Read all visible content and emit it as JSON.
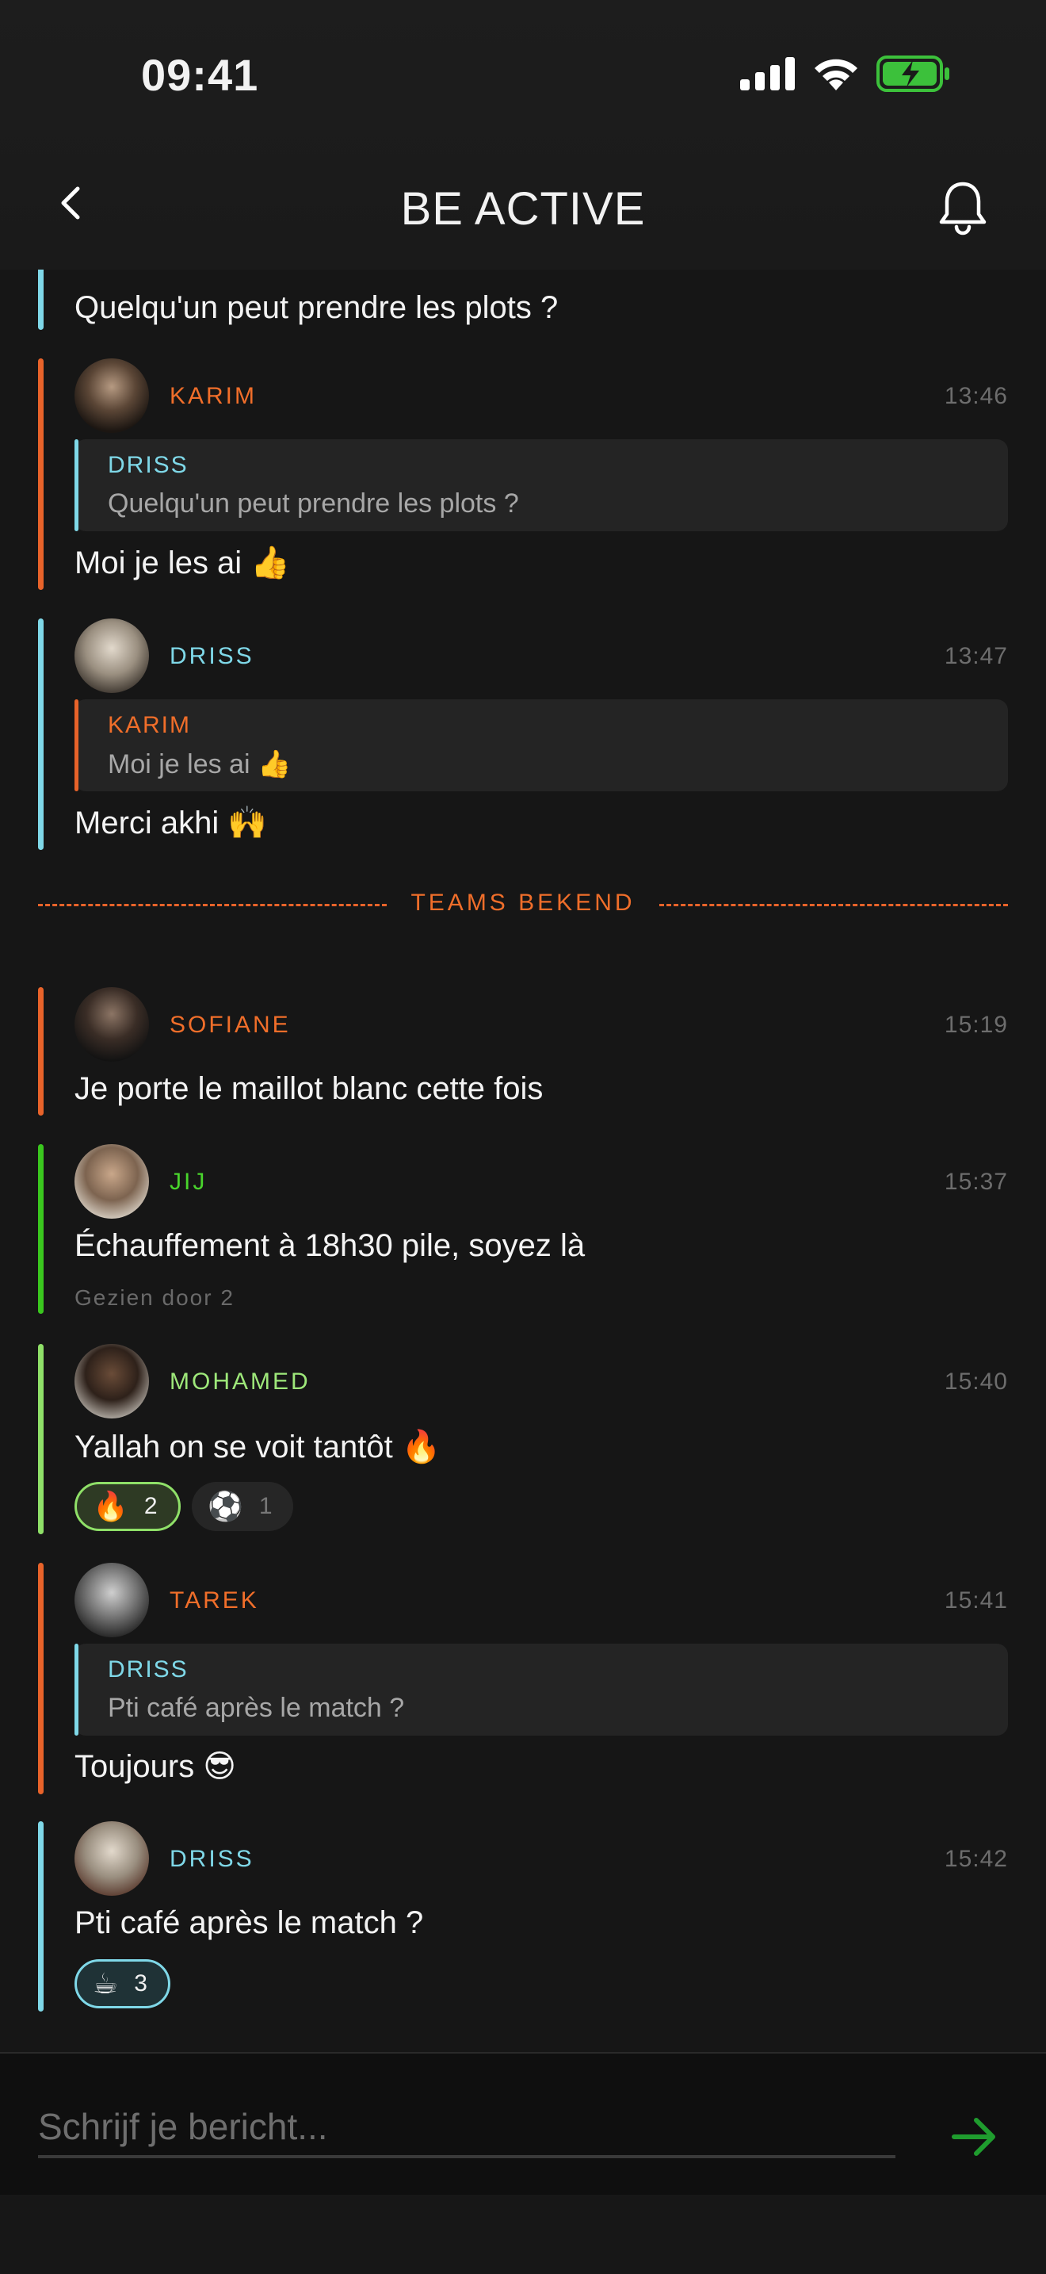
{
  "status_bar": {
    "time": "09:41"
  },
  "header": {
    "title": "BE ACTIVE"
  },
  "messages": [
    {
      "text": "Quelqu'un peut prendre les plots ?"
    },
    {
      "name": "KARIM",
      "time": "13:46",
      "quote_name": "DRISS",
      "quote_text": "Quelqu'un peut prendre les plots ?",
      "text": "Moi je les ai 👍"
    },
    {
      "name": "DRISS",
      "time": "13:47",
      "quote_name": "KARIM",
      "quote_text": "Moi je les ai 👍",
      "text": "Merci akhi 🙌"
    },
    {
      "name": "SOFIANE",
      "time": "15:19",
      "text": "Je porte le maillot blanc cette fois"
    },
    {
      "name": "JIJ",
      "time": "15:37",
      "text": "Échauffement à 18h30 pile, soyez là",
      "seen": "Gezien door 2"
    },
    {
      "name": "MOHAMED",
      "time": "15:40",
      "text": "Yallah on se voit tantôt 🔥",
      "reactions": [
        {
          "emoji": "🔥",
          "count": "2"
        },
        {
          "emoji": "⚽",
          "count": "1"
        }
      ]
    },
    {
      "name": "TAREK",
      "time": "15:41",
      "quote_name": "DRISS",
      "quote_text": "Pti café après le match ?",
      "text": "Toujours 😎"
    },
    {
      "name": "DRISS",
      "time": "15:42",
      "text": "Pti café après le match ?",
      "reactions": [
        {
          "emoji": "☕",
          "count": "3"
        }
      ]
    }
  ],
  "divider": {
    "label": "TEAMS BEKEND"
  },
  "composer": {
    "placeholder": "Schrijf je bericht..."
  },
  "colors": {
    "accent_orange": "#e8632a",
    "accent_cyan": "#7fd8e8",
    "accent_green": "#3ac71e",
    "accent_light_green": "#8fe068",
    "send_arrow": "#1f9c2e"
  },
  "icons": {
    "back": "chevron-left-icon",
    "bell": "bell-icon",
    "send": "arrow-right-icon",
    "signal": "signal-icon",
    "wifi": "wifi-icon",
    "battery": "battery-charging-icon"
  }
}
